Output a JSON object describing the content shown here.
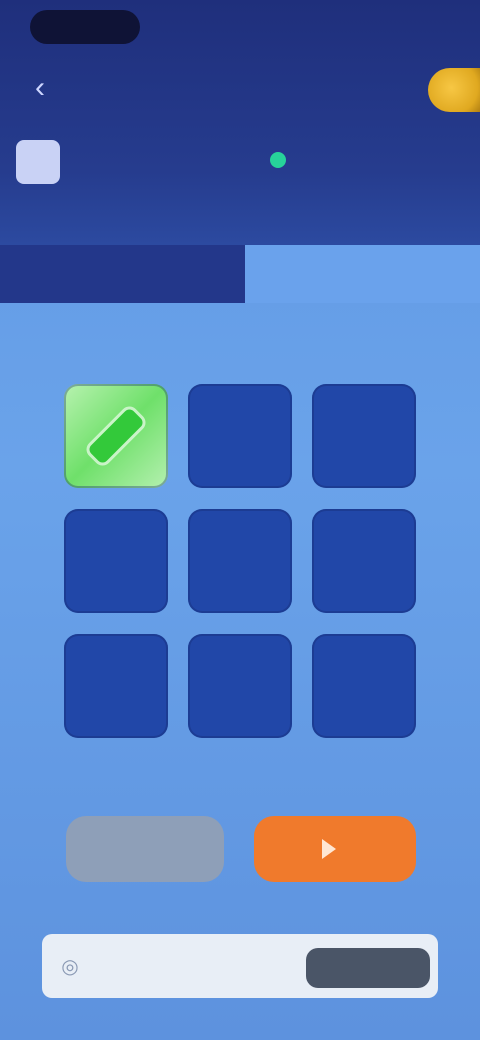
{
  "header": {
    "back_icon": "chevron-left-icon",
    "title": "",
    "coin_icon": "coin-icon",
    "avatar_icon": "avatar-icon",
    "online_text": ""
  },
  "tabs": [
    {
      "label": ""
    },
    {
      "label": ""
    }
  ],
  "grid": {
    "rows": 3,
    "cols": 3,
    "revealed_index": 0,
    "revealed_icon": "gem-icon"
  },
  "actions": {
    "grey_label": "",
    "orange_label": "",
    "orange_icon": "play-icon"
  },
  "bet": {
    "icon": "coin-icon",
    "placeholder": "",
    "button_label": ""
  },
  "colors": {
    "header_bg": "#1f2f7c",
    "page_bg": "#6aa3ea",
    "tile": "#2147a8",
    "revealed_tile": "#6fe06a",
    "accent_orange": "#f07a2c",
    "online": "#27d39a"
  }
}
